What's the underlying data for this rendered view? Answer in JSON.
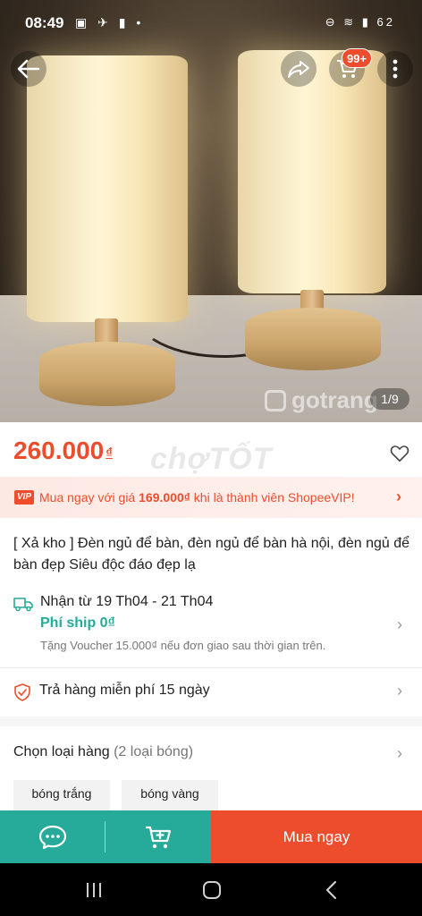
{
  "status_bar": {
    "time": "08:49",
    "left_icons": "▣ ✈ ▮ •",
    "right_icons": "⊖ ≋ ▮ 62",
    "icon_names": [
      "gallery-icon",
      "airplane-icon",
      "sim-icon",
      "dot-icon",
      "dnd-icon",
      "wifi-icon",
      "signal-icon",
      "battery-icon"
    ]
  },
  "image": {
    "counter": "1/9",
    "watermark": "gotrang",
    "cart_badge": "99+"
  },
  "product": {
    "price": "260.000",
    "currency": "₫",
    "watermark": "chợTỐT",
    "title": "[ Xả kho ] Đèn ngủ để bàn, đèn ngủ để bàn hà nội, đèn ngủ để bàn đẹp Siêu độc đáo đẹp lạ"
  },
  "vip": {
    "badge": "VIP",
    "text_prefix": "Mua ngay với giá ",
    "price": "169.000₫",
    "text_suffix": " khi là thành viên ShopeeVIP!"
  },
  "shipping": {
    "line1": "Nhận từ 19 Th04 - 21 Th04",
    "line2": "Phí ship 0₫",
    "line3": "Tặng Voucher 15.000₫ nếu đơn giao sau thời gian trên."
  },
  "returns": {
    "text": "Trả hàng miễn phí 15 ngày"
  },
  "variants": {
    "label": "Chọn loại hàng",
    "count": "(2 loại bóng)",
    "options": [
      "bóng trắng",
      "bóng vàng"
    ]
  },
  "actions": {
    "buy_now": "Mua ngay"
  },
  "colors": {
    "accent": "#ee4d2d",
    "teal": "#26aa99"
  }
}
